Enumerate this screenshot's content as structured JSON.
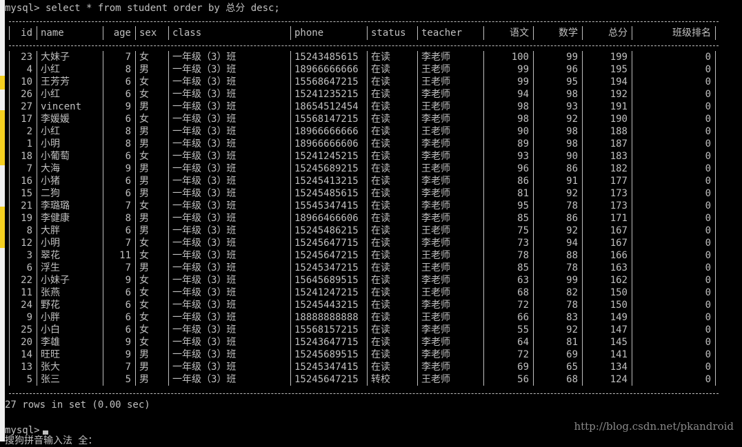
{
  "terminal": {
    "command_line": "mysql> select * from student order by 总分 desc;",
    "result_summary": "27 rows in set (0.00 sec)",
    "prompt": "mysql>",
    "ime_status": "搜狗拼音输入法 全：",
    "watermark": "http://blog.csdn.net/pkandroid",
    "text_color": "#c0c0c0",
    "background": "#000000"
  },
  "table": {
    "columns": [
      "id",
      "name",
      "age",
      "sex",
      "class",
      "phone",
      "status",
      "teacher",
      "语文",
      "数学",
      "总分",
      "班级排名"
    ],
    "rows": [
      [
        "23",
        "大妹子",
        "7",
        "女",
        "一年级（3）班",
        "15243485615",
        "在读",
        "李老师",
        "100",
        "99",
        "199",
        "0"
      ],
      [
        "4",
        "小红",
        "8",
        "男",
        "一年级（3）班",
        "18966666666",
        "在读",
        "王老师",
        "99",
        "96",
        "195",
        "0"
      ],
      [
        "10",
        "王芳芳",
        "6",
        "女",
        "一年级（3）班",
        "15568647215",
        "在读",
        "王老师",
        "99",
        "95",
        "194",
        "0"
      ],
      [
        "26",
        "小红",
        "6",
        "女",
        "一年级（3）班",
        "15241235215",
        "在读",
        "李老师",
        "94",
        "98",
        "192",
        "0"
      ],
      [
        "27",
        "vincent",
        "9",
        "男",
        "一年级（3）班",
        "18654512454",
        "在读",
        "王老师",
        "98",
        "93",
        "191",
        "0"
      ],
      [
        "17",
        "李媛媛",
        "6",
        "女",
        "一年级（3）班",
        "15568147215",
        "在读",
        "李老师",
        "98",
        "92",
        "190",
        "0"
      ],
      [
        "2",
        "小红",
        "8",
        "男",
        "一年级（3）班",
        "18966666666",
        "在读",
        "王老师",
        "90",
        "98",
        "188",
        "0"
      ],
      [
        "1",
        "小明",
        "8",
        "男",
        "一年级（3）班",
        "18966666606",
        "在读",
        "李老师",
        "89",
        "98",
        "187",
        "0"
      ],
      [
        "18",
        "小葡萄",
        "6",
        "女",
        "一年级（3）班",
        "15241245215",
        "在读",
        "李老师",
        "93",
        "90",
        "183",
        "0"
      ],
      [
        "7",
        "大海",
        "9",
        "男",
        "一年级（3）班",
        "15245689215",
        "在读",
        "王老师",
        "96",
        "86",
        "182",
        "0"
      ],
      [
        "16",
        "小猪",
        "6",
        "男",
        "一年级（3）班",
        "15245413215",
        "在读",
        "李老师",
        "86",
        "91",
        "177",
        "0"
      ],
      [
        "15",
        "二狗",
        "6",
        "男",
        "一年级（3）班",
        "15245485615",
        "在读",
        "李老师",
        "81",
        "92",
        "173",
        "0"
      ],
      [
        "21",
        "李璐璐",
        "7",
        "女",
        "一年级（3）班",
        "15545347415",
        "在读",
        "李老师",
        "95",
        "78",
        "173",
        "0"
      ],
      [
        "19",
        "李健康",
        "8",
        "男",
        "一年级（3）班",
        "18966466606",
        "在读",
        "李老师",
        "85",
        "86",
        "171",
        "0"
      ],
      [
        "8",
        "大胖",
        "6",
        "男",
        "一年级（3）班",
        "15245486215",
        "在读",
        "王老师",
        "75",
        "92",
        "167",
        "0"
      ],
      [
        "12",
        "小明",
        "7",
        "女",
        "一年级（3）班",
        "15245647715",
        "在读",
        "李老师",
        "73",
        "94",
        "167",
        "0"
      ],
      [
        "3",
        "翠花",
        "11",
        "女",
        "一年级（3）班",
        "15245647215",
        "在读",
        "王老师",
        "78",
        "88",
        "166",
        "0"
      ],
      [
        "6",
        "浮生",
        "7",
        "男",
        "一年级（3）班",
        "15245347215",
        "在读",
        "王老师",
        "85",
        "78",
        "163",
        "0"
      ],
      [
        "22",
        "小妹子",
        "9",
        "女",
        "一年级（3）班",
        "15645689515",
        "在读",
        "李老师",
        "63",
        "99",
        "162",
        "0"
      ],
      [
        "11",
        "张燕",
        "6",
        "女",
        "一年级（3）班",
        "15241247215",
        "在读",
        "王老师",
        "68",
        "82",
        "150",
        "0"
      ],
      [
        "24",
        "野花",
        "6",
        "女",
        "一年级（3）班",
        "15245443215",
        "在读",
        "李老师",
        "72",
        "78",
        "150",
        "0"
      ],
      [
        "9",
        "小胖",
        "6",
        "女",
        "一年级（3）班",
        "18888888888",
        "在读",
        "王老师",
        "66",
        "83",
        "149",
        "0"
      ],
      [
        "25",
        "小白",
        "6",
        "女",
        "一年级（3）班",
        "15568157215",
        "在读",
        "李老师",
        "55",
        "92",
        "147",
        "0"
      ],
      [
        "20",
        "李雄",
        "9",
        "女",
        "一年级（3）班",
        "15243647715",
        "在读",
        "李老师",
        "64",
        "81",
        "145",
        "0"
      ],
      [
        "14",
        "旺旺",
        "9",
        "男",
        "一年级（3）班",
        "15245689515",
        "在读",
        "李老师",
        "72",
        "69",
        "141",
        "0"
      ],
      [
        "13",
        "张大",
        "7",
        "男",
        "一年级（3）班",
        "15245347415",
        "在读",
        "李老师",
        "69",
        "65",
        "134",
        "0"
      ],
      [
        "5",
        "张三",
        "5",
        "男",
        "一年级（3）班",
        "15245647215",
        "转校",
        "王老师",
        "56",
        "68",
        "124",
        "0"
      ]
    ]
  }
}
